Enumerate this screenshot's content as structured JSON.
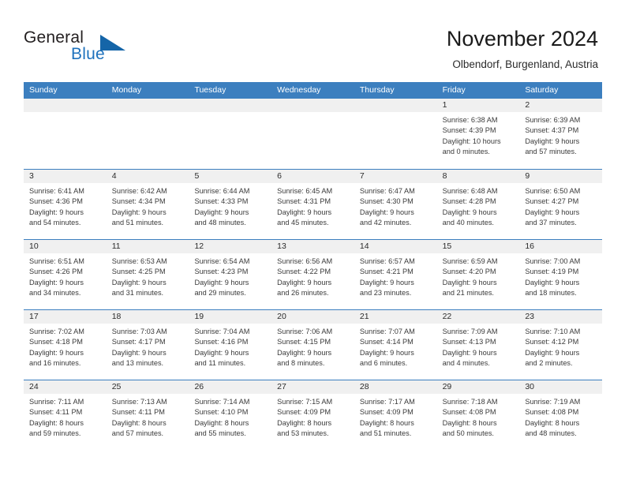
{
  "brand": {
    "name_part1": "General",
    "name_part2": "Blue",
    "logo_icon": "triangle-logo-icon",
    "accent_color": "#1f72bd"
  },
  "header": {
    "title": "November 2024",
    "subtitle": "Olbendorf, Burgenland, Austria"
  },
  "calendar": {
    "header_color": "#3c7fbf",
    "weekdays": [
      "Sunday",
      "Monday",
      "Tuesday",
      "Wednesday",
      "Thursday",
      "Friday",
      "Saturday"
    ],
    "weeks": [
      [
        {
          "day": "",
          "empty": true
        },
        {
          "day": "",
          "empty": true
        },
        {
          "day": "",
          "empty": true
        },
        {
          "day": "",
          "empty": true
        },
        {
          "day": "",
          "empty": true
        },
        {
          "day": "1",
          "sunrise": "Sunrise: 6:38 AM",
          "sunset": "Sunset: 4:39 PM",
          "daylight1": "Daylight: 10 hours",
          "daylight2": "and 0 minutes."
        },
        {
          "day": "2",
          "sunrise": "Sunrise: 6:39 AM",
          "sunset": "Sunset: 4:37 PM",
          "daylight1": "Daylight: 9 hours",
          "daylight2": "and 57 minutes."
        }
      ],
      [
        {
          "day": "3",
          "sunrise": "Sunrise: 6:41 AM",
          "sunset": "Sunset: 4:36 PM",
          "daylight1": "Daylight: 9 hours",
          "daylight2": "and 54 minutes."
        },
        {
          "day": "4",
          "sunrise": "Sunrise: 6:42 AM",
          "sunset": "Sunset: 4:34 PM",
          "daylight1": "Daylight: 9 hours",
          "daylight2": "and 51 minutes."
        },
        {
          "day": "5",
          "sunrise": "Sunrise: 6:44 AM",
          "sunset": "Sunset: 4:33 PM",
          "daylight1": "Daylight: 9 hours",
          "daylight2": "and 48 minutes."
        },
        {
          "day": "6",
          "sunrise": "Sunrise: 6:45 AM",
          "sunset": "Sunset: 4:31 PM",
          "daylight1": "Daylight: 9 hours",
          "daylight2": "and 45 minutes."
        },
        {
          "day": "7",
          "sunrise": "Sunrise: 6:47 AM",
          "sunset": "Sunset: 4:30 PM",
          "daylight1": "Daylight: 9 hours",
          "daylight2": "and 42 minutes."
        },
        {
          "day": "8",
          "sunrise": "Sunrise: 6:48 AM",
          "sunset": "Sunset: 4:28 PM",
          "daylight1": "Daylight: 9 hours",
          "daylight2": "and 40 minutes."
        },
        {
          "day": "9",
          "sunrise": "Sunrise: 6:50 AM",
          "sunset": "Sunset: 4:27 PM",
          "daylight1": "Daylight: 9 hours",
          "daylight2": "and 37 minutes."
        }
      ],
      [
        {
          "day": "10",
          "sunrise": "Sunrise: 6:51 AM",
          "sunset": "Sunset: 4:26 PM",
          "daylight1": "Daylight: 9 hours",
          "daylight2": "and 34 minutes."
        },
        {
          "day": "11",
          "sunrise": "Sunrise: 6:53 AM",
          "sunset": "Sunset: 4:25 PM",
          "daylight1": "Daylight: 9 hours",
          "daylight2": "and 31 minutes."
        },
        {
          "day": "12",
          "sunrise": "Sunrise: 6:54 AM",
          "sunset": "Sunset: 4:23 PM",
          "daylight1": "Daylight: 9 hours",
          "daylight2": "and 29 minutes."
        },
        {
          "day": "13",
          "sunrise": "Sunrise: 6:56 AM",
          "sunset": "Sunset: 4:22 PM",
          "daylight1": "Daylight: 9 hours",
          "daylight2": "and 26 minutes."
        },
        {
          "day": "14",
          "sunrise": "Sunrise: 6:57 AM",
          "sunset": "Sunset: 4:21 PM",
          "daylight1": "Daylight: 9 hours",
          "daylight2": "and 23 minutes."
        },
        {
          "day": "15",
          "sunrise": "Sunrise: 6:59 AM",
          "sunset": "Sunset: 4:20 PM",
          "daylight1": "Daylight: 9 hours",
          "daylight2": "and 21 minutes."
        },
        {
          "day": "16",
          "sunrise": "Sunrise: 7:00 AM",
          "sunset": "Sunset: 4:19 PM",
          "daylight1": "Daylight: 9 hours",
          "daylight2": "and 18 minutes."
        }
      ],
      [
        {
          "day": "17",
          "sunrise": "Sunrise: 7:02 AM",
          "sunset": "Sunset: 4:18 PM",
          "daylight1": "Daylight: 9 hours",
          "daylight2": "and 16 minutes."
        },
        {
          "day": "18",
          "sunrise": "Sunrise: 7:03 AM",
          "sunset": "Sunset: 4:17 PM",
          "daylight1": "Daylight: 9 hours",
          "daylight2": "and 13 minutes."
        },
        {
          "day": "19",
          "sunrise": "Sunrise: 7:04 AM",
          "sunset": "Sunset: 4:16 PM",
          "daylight1": "Daylight: 9 hours",
          "daylight2": "and 11 minutes."
        },
        {
          "day": "20",
          "sunrise": "Sunrise: 7:06 AM",
          "sunset": "Sunset: 4:15 PM",
          "daylight1": "Daylight: 9 hours",
          "daylight2": "and 8 minutes."
        },
        {
          "day": "21",
          "sunrise": "Sunrise: 7:07 AM",
          "sunset": "Sunset: 4:14 PM",
          "daylight1": "Daylight: 9 hours",
          "daylight2": "and 6 minutes."
        },
        {
          "day": "22",
          "sunrise": "Sunrise: 7:09 AM",
          "sunset": "Sunset: 4:13 PM",
          "daylight1": "Daylight: 9 hours",
          "daylight2": "and 4 minutes."
        },
        {
          "day": "23",
          "sunrise": "Sunrise: 7:10 AM",
          "sunset": "Sunset: 4:12 PM",
          "daylight1": "Daylight: 9 hours",
          "daylight2": "and 2 minutes."
        }
      ],
      [
        {
          "day": "24",
          "sunrise": "Sunrise: 7:11 AM",
          "sunset": "Sunset: 4:11 PM",
          "daylight1": "Daylight: 8 hours",
          "daylight2": "and 59 minutes."
        },
        {
          "day": "25",
          "sunrise": "Sunrise: 7:13 AM",
          "sunset": "Sunset: 4:11 PM",
          "daylight1": "Daylight: 8 hours",
          "daylight2": "and 57 minutes."
        },
        {
          "day": "26",
          "sunrise": "Sunrise: 7:14 AM",
          "sunset": "Sunset: 4:10 PM",
          "daylight1": "Daylight: 8 hours",
          "daylight2": "and 55 minutes."
        },
        {
          "day": "27",
          "sunrise": "Sunrise: 7:15 AM",
          "sunset": "Sunset: 4:09 PM",
          "daylight1": "Daylight: 8 hours",
          "daylight2": "and 53 minutes."
        },
        {
          "day": "28",
          "sunrise": "Sunrise: 7:17 AM",
          "sunset": "Sunset: 4:09 PM",
          "daylight1": "Daylight: 8 hours",
          "daylight2": "and 51 minutes."
        },
        {
          "day": "29",
          "sunrise": "Sunrise: 7:18 AM",
          "sunset": "Sunset: 4:08 PM",
          "daylight1": "Daylight: 8 hours",
          "daylight2": "and 50 minutes."
        },
        {
          "day": "30",
          "sunrise": "Sunrise: 7:19 AM",
          "sunset": "Sunset: 4:08 PM",
          "daylight1": "Daylight: 8 hours",
          "daylight2": "and 48 minutes."
        }
      ]
    ]
  }
}
